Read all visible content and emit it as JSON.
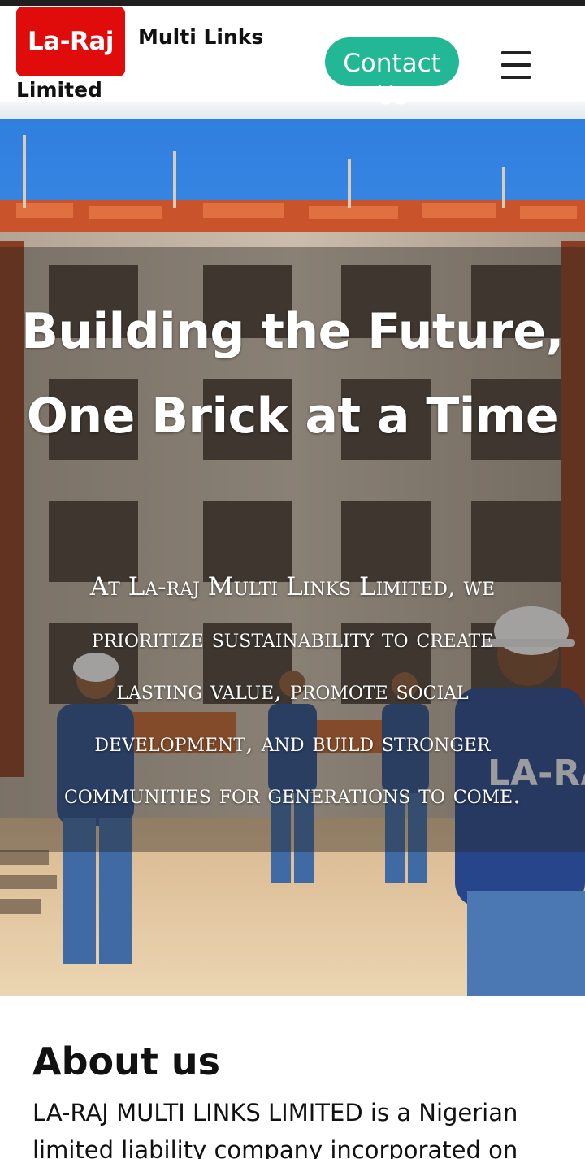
{
  "header": {
    "logo_text": "La-Raj",
    "brand_rest": "Multi Links",
    "brand_line2": "Limited",
    "contact_line1": "Contact",
    "contact_line2": "Us",
    "menu_icon": "hamburger-menu-icon"
  },
  "hero": {
    "title_line1": "Building the Future,",
    "title_line2": "One Brick at a Time",
    "subtitle_lines": [
      "At La-raj Multi Links Limited, we",
      "prioritize sustainability to create",
      "lasting value, promote social",
      "development, and build stronger",
      "communities for generations to come."
    ],
    "image_vest_text": "LA-RAJ"
  },
  "about": {
    "title": "About us",
    "body_lines": [
      "LA-RAJ MULTI LINKS LIMITED is a Nigerian",
      "limited liability company incorporated on"
    ]
  },
  "colors": {
    "logo_red": "#e00b0b",
    "contact_green": "#22b895",
    "text_dark": "#111111"
  }
}
